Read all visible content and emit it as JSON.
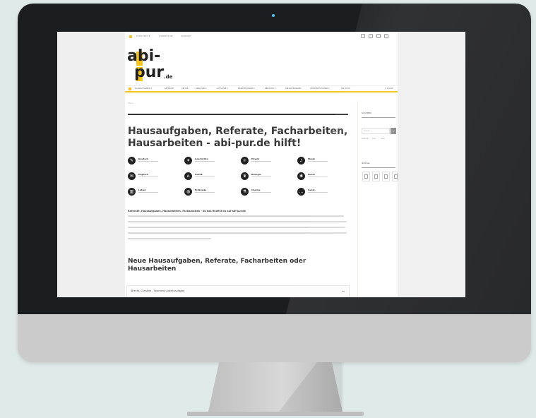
{
  "colors": {
    "accent": "#f4c21a",
    "background": "#dfe9e8",
    "bezel": "#1c1d1f"
  },
  "topbar": {
    "links": [
      "STARTSEITE",
      "IMPRESSUM",
      "KONTAKT"
    ],
    "social_icons": [
      "facebook-icon",
      "twitter-icon",
      "google-plus-icon",
      "rss-icon"
    ]
  },
  "logo": {
    "line1": "abi-",
    "line2": "pur",
    "tld": ".de"
  },
  "nav": {
    "items": [
      "HAUSAUFGABEN ▾",
      "REFERATE",
      "ABITUR",
      "ANALYSEN ▾",
      "AUFSÄTZE ▾",
      "ERÖRTERUNGEN ▾",
      "BERICHTE ▾",
      "ABI-MATERIALIEN",
      "INTERPRETATIONEN ▾",
      "ABI-SHOP"
    ],
    "search": "Q SUCHE"
  },
  "main": {
    "breadcrumb": "Home",
    "headline": "Hausaufgaben, Referate, Facharbeiten, Hausarbeiten - abi-pur.de hilft!",
    "subjects": [
      {
        "name": "Deutsch",
        "icon": "book-icon",
        "glyph": "✎"
      },
      {
        "name": "Geschichte",
        "icon": "scroll-icon",
        "glyph": "✦"
      },
      {
        "name": "Physik",
        "icon": "atom-icon",
        "glyph": "⚛"
      },
      {
        "name": "Musik",
        "icon": "music-icon",
        "glyph": "♪"
      },
      {
        "name": "Englisch",
        "icon": "flag-icon",
        "glyph": "✉"
      },
      {
        "name": "Politik",
        "icon": "building-icon",
        "glyph": "⌂"
      },
      {
        "name": "Biologie",
        "icon": "leaf-icon",
        "glyph": "❦"
      },
      {
        "name": "Kunst",
        "icon": "palette-icon",
        "glyph": "✱"
      },
      {
        "name": "Latein",
        "icon": "column-icon",
        "glyph": "▥"
      },
      {
        "name": "Erdkunde",
        "icon": "globe-icon",
        "glyph": "◍"
      },
      {
        "name": "Chemie",
        "icon": "flask-icon",
        "glyph": "⚗"
      },
      {
        "name": "Sonst.",
        "icon": "dots-icon",
        "glyph": "…"
      }
    ],
    "intro_title": "Referate, Hausaufgaben, Hausarbeiten, Facharbeiten - all das findest du auf abi-pur.de",
    "section_title": "Neue Hausaufgaben, Referate, Facharbeiten oder Hausarbeiten",
    "first_item": "Brecht, Christine - Townsend Arbeitsaufgabe"
  },
  "sidebar": {
    "search_heading": "SUCHEN",
    "search_placeholder": "Suchen...",
    "search_button": "⌕",
    "search_options": [
      "Referate",
      "Titel",
      "Alles"
    ],
    "social_heading": "SOCIAL"
  }
}
